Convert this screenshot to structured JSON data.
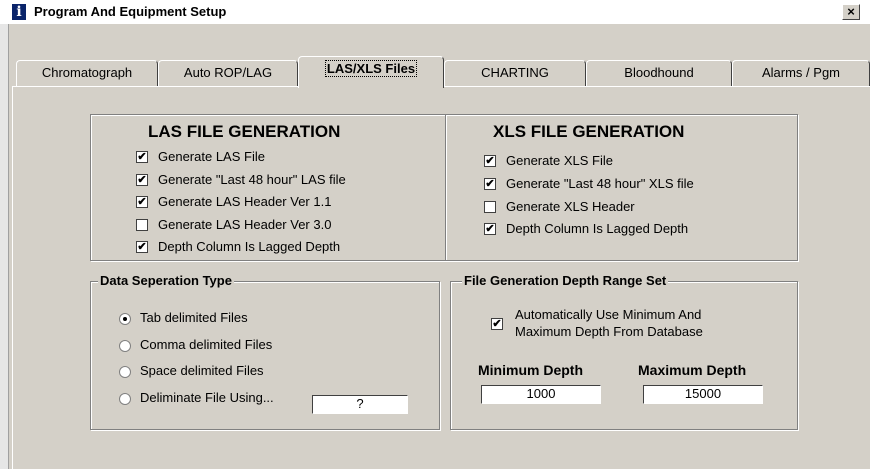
{
  "window": {
    "title": "Program And Equipment Setup",
    "icon": "info-icon",
    "close_label": "×"
  },
  "tabs": [
    {
      "label": "Chromatograph",
      "active": false
    },
    {
      "label": "Auto ROP/LAG",
      "active": false
    },
    {
      "label": "LAS/XLS Files",
      "active": true
    },
    {
      "label": "CHARTING",
      "active": false
    },
    {
      "label": "Bloodhound",
      "active": false
    },
    {
      "label": "Alarms / Pgm",
      "active": false
    }
  ],
  "las": {
    "title": "LAS FILE GENERATION",
    "options": [
      {
        "label": "Generate LAS File",
        "checked": true
      },
      {
        "label": "Generate \"Last 48 hour\" LAS file",
        "checked": true
      },
      {
        "label": "Generate LAS Header Ver 1.1",
        "checked": true
      },
      {
        "label": "Generate LAS Header Ver 3.0",
        "checked": false
      },
      {
        "label": "Depth Column Is Lagged Depth",
        "checked": true
      }
    ]
  },
  "xls": {
    "title": "XLS FILE GENERATION",
    "options": [
      {
        "label": "Generate XLS File",
        "checked": true
      },
      {
        "label": "Generate \"Last 48 hour\" XLS file",
        "checked": true
      },
      {
        "label": "Generate XLS Header",
        "checked": false
      },
      {
        "label": "Depth Column Is Lagged Depth",
        "checked": true
      }
    ]
  },
  "separation": {
    "title": "Data Seperation Type",
    "options": [
      {
        "label": "Tab delimited Files",
        "selected": true
      },
      {
        "label": "Comma delimited Files",
        "selected": false
      },
      {
        "label": "Space delimited Files",
        "selected": false
      },
      {
        "label": "Deliminate File Using...",
        "selected": false
      }
    ],
    "custom_delimiter": "?"
  },
  "depth_range": {
    "title": "File Generation Depth Range Set",
    "auto_label_line1": "Automatically Use Minimum And",
    "auto_label_line2": "Maximum Depth From Database",
    "auto_checked": true,
    "min_label": "Minimum Depth",
    "min_value": "1000",
    "max_label": "Maximum Depth",
    "max_value": "15000"
  },
  "check_mark": "✔"
}
